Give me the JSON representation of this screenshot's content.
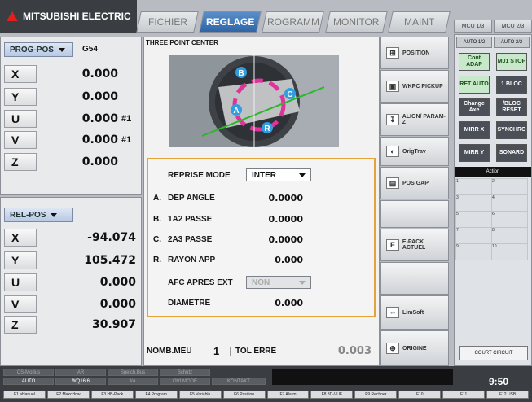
{
  "brand": "MITSUBISHI ELECTRIC",
  "tabs": [
    "FICHIER",
    "REGLAGE",
    "ROGRAMM",
    "MONITOR",
    "MAINT"
  ],
  "mcu_tabs": [
    "MCU 1/3",
    "MCU 2/3"
  ],
  "mcu_header": [
    "AUTO 1/2",
    "AUTO 2/2"
  ],
  "prog_pos": {
    "select": "PROG-POS",
    "coord": "G54",
    "axes": [
      {
        "name": "X",
        "value": "0.000",
        "suffix": ""
      },
      {
        "name": "Y",
        "value": "0.000",
        "suffix": ""
      },
      {
        "name": "U",
        "value": "0.000",
        "suffix": "#1"
      },
      {
        "name": "V",
        "value": "0.000",
        "suffix": "#1"
      },
      {
        "name": "Z",
        "value": "0.000",
        "suffix": ""
      }
    ]
  },
  "rel_pos": {
    "select": "REL-POS",
    "axes": [
      {
        "name": "X",
        "value": "-94.074"
      },
      {
        "name": "Y",
        "value": "105.472"
      },
      {
        "name": "U",
        "value": "0.000"
      },
      {
        "name": "V",
        "value": "0.000"
      },
      {
        "name": "Z",
        "value": "30.907"
      }
    ]
  },
  "center": {
    "title": "THREE POINT CENTER",
    "markers": [
      "A",
      "B",
      "C",
      "R"
    ]
  },
  "form": {
    "reprise": {
      "label": "REPRISE MODE",
      "value": "INTER"
    },
    "rows": [
      {
        "letter": "A.",
        "label": "DEP ANGLE",
        "value": "0.0000"
      },
      {
        "letter": "B.",
        "label": "1A2 PASSE",
        "value": "0.0000"
      },
      {
        "letter": "C.",
        "label": "2A3 PASSE",
        "value": "0.0000"
      },
      {
        "letter": "R.",
        "label": "RAYON APP",
        "value": "0.000"
      }
    ],
    "afc": {
      "label": "AFC APRES EXT",
      "value": "NON"
    },
    "diametre": {
      "label": "DIAMETRE",
      "value": "0.000"
    }
  },
  "nomb": {
    "label": "NOMB.MEU",
    "value": "1",
    "tol_label": "TOL ERRE",
    "tol_value": "0.003"
  },
  "right_buttons": [
    "POSITION",
    "WKPC PICKUP",
    "ALIGN/ PARAM-Z",
    "OrigTrav",
    "POS GAP",
    "",
    "E-PACK ACTUEL",
    "",
    "LimSoft",
    "ORIGINE"
  ],
  "side_buttons": [
    [
      "Cont ADAP",
      "M01 STOP"
    ],
    [
      "RET AUTO",
      "1 BLOC"
    ],
    [
      "Change Axe",
      "/BLOC RESET"
    ],
    [
      "MIRR X",
      "SYNCHRO"
    ],
    [
      "MIRR Y",
      "SONARD"
    ]
  ],
  "action": "Action",
  "grid_nums": [
    "1",
    "2",
    "3",
    "4",
    "5",
    "6",
    "7",
    "8",
    "9",
    "10"
  ],
  "court_circuit": "COURT CIRCUIT",
  "status_top": [
    "CS-Modus",
    "AR",
    "Speich.Bus",
    "Schutz"
  ],
  "status_bottom": [
    "AUTO",
    "WQ16.6",
    "I/A",
    "OVI.MODE",
    "KONTAKT"
  ],
  "time": "9:50",
  "fkeys": [
    "F1 aHanuel",
    "F2 MaxcHow",
    "F3 HB-Pack",
    "F4 Program",
    "F5 Variable",
    "F6 Position",
    "F7 Alarm",
    "F8 3D-VUE",
    "F9 Rechner",
    "F10",
    "F11",
    "F12 USB"
  ]
}
